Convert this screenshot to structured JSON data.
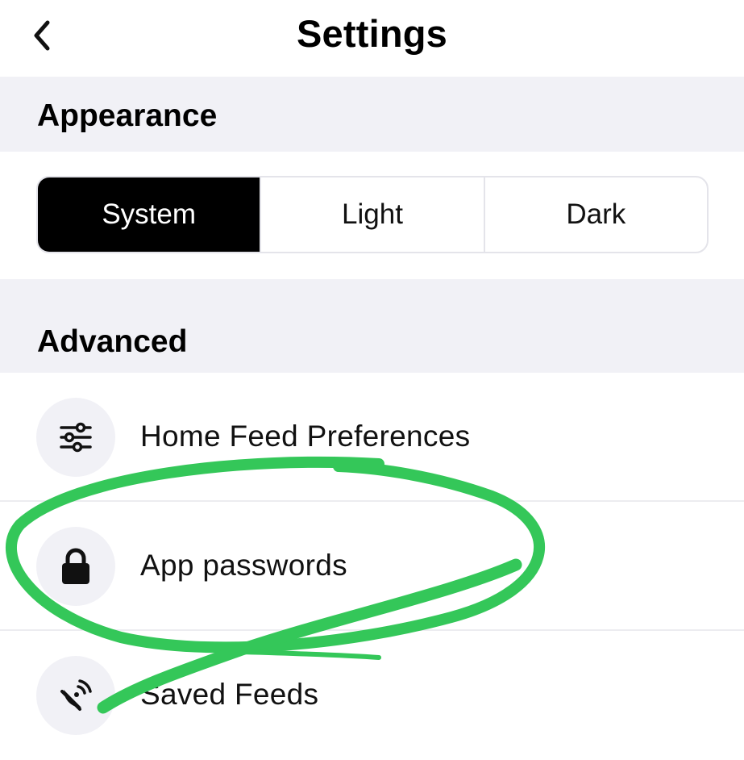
{
  "header": {
    "title": "Settings",
    "back_icon": "chevron-left-icon"
  },
  "appearance": {
    "section_title": "Appearance",
    "options": [
      "System",
      "Light",
      "Dark"
    ],
    "selected": "System"
  },
  "advanced": {
    "section_title": "Advanced",
    "items": [
      {
        "label": "Home Feed Preferences",
        "icon": "sliders-icon"
      },
      {
        "label": "App passwords",
        "icon": "lock-icon"
      },
      {
        "label": "Saved Feeds",
        "icon": "satellite-dish-icon"
      }
    ]
  },
  "annotation": {
    "color": "#34c759",
    "description_shape": "hand-drawn-circle-around-app-passwords"
  },
  "colors": {
    "background": "#ffffff",
    "section_background": "#f1f1f6",
    "selected_segment": "#000000",
    "icon_circle": "#f1f1f6"
  }
}
